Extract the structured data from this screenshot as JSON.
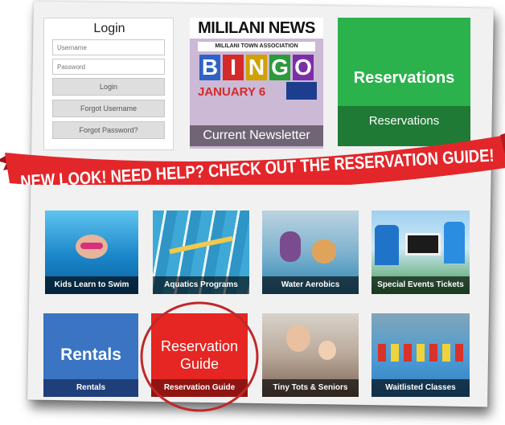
{
  "login": {
    "title": "Login",
    "username_placeholder": "Username",
    "password_placeholder": "Password",
    "login_label": "Login",
    "forgot_username_label": "Forgot Username",
    "forgot_password_label": "Forgot Password?"
  },
  "newsletter": {
    "masthead": "MILILANI NEWS",
    "subhead": "MILILANI TOWN ASSOCIATION",
    "bingo_letters": [
      "B",
      "I",
      "N",
      "G",
      "O"
    ],
    "date": "JANUARY 6",
    "caption": "Current Newsletter"
  },
  "reservations": {
    "big_label": "Reservations",
    "caption": "Reservations"
  },
  "banner": {
    "text": "NEW LOOK! NEED HELP? CHECK OUT THE RESERVATION GUIDE!",
    "color": "#e3262a"
  },
  "tiles": {
    "kids_swim": "Kids Learn to Swim",
    "aquatics": "Aquatics Programs",
    "water_aerobics": "Water Aerobics",
    "special_events": "Special Events Tickets",
    "rentals_big": "Rentals",
    "rentals": "Rentals",
    "guide_big_line1": "Reservation",
    "guide_big_line2": "Guide",
    "guide": "Reservation Guide",
    "tiny_tots": "Tiny Tots & Seniors",
    "waitlisted": "Waitlisted Classes"
  },
  "colors": {
    "reservations_green": "#2bb24c",
    "rentals_blue": "#3a74c2",
    "guide_red": "#e52622",
    "highlight_circle": "#c0282a"
  }
}
